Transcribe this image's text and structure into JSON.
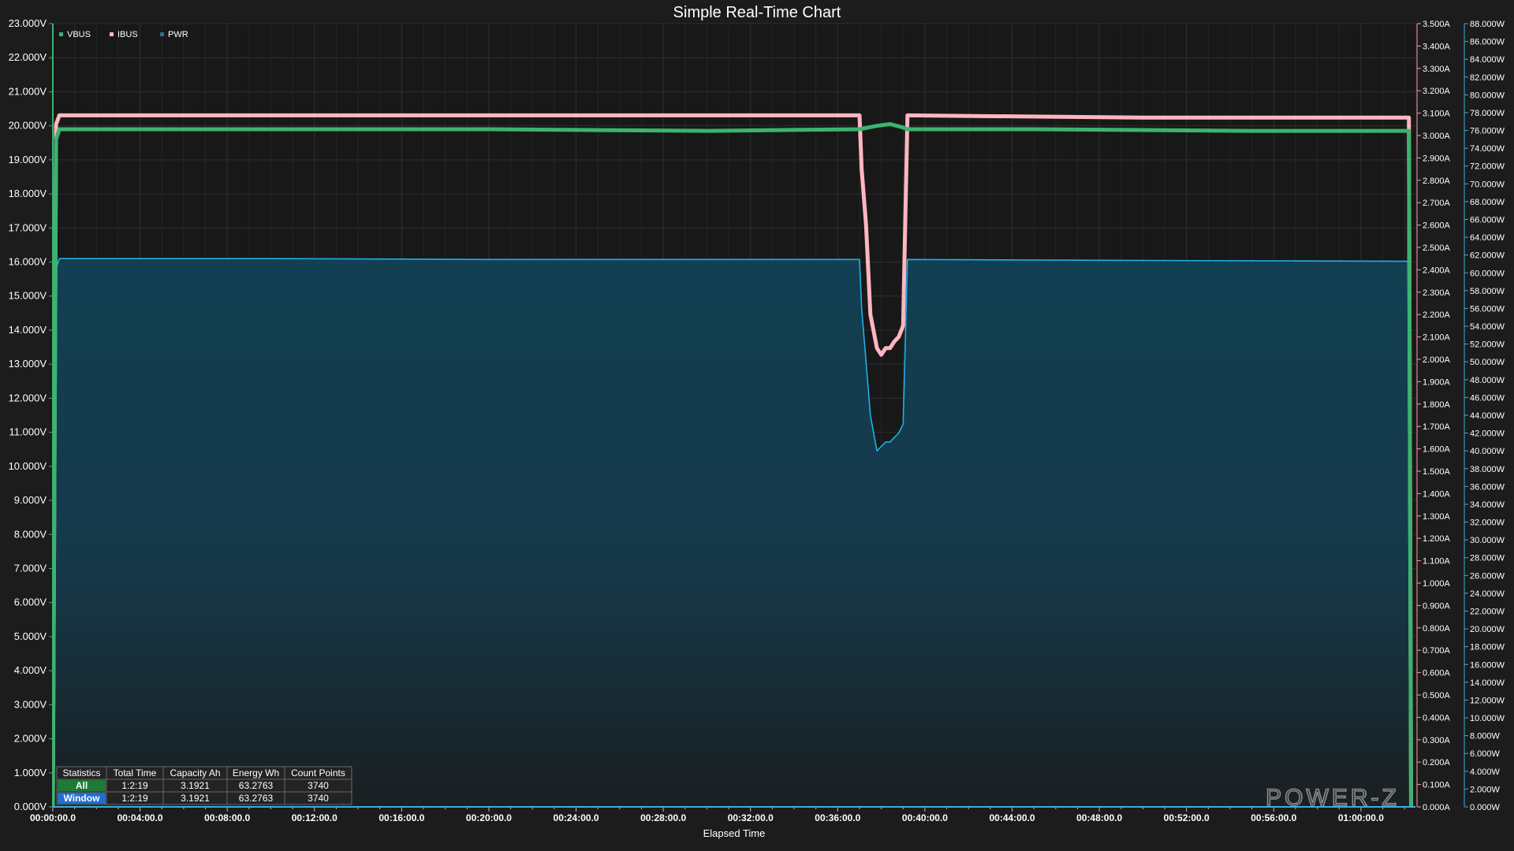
{
  "chart_data": {
    "type": "line",
    "title": "Simple Real-Time Chart",
    "xlabel": "Elapsed Time",
    "x_unit": "minutes",
    "xlim": [
      0,
      62.5
    ],
    "x_ticks": [
      {
        "value": 0,
        "label": "00:00:00.0"
      },
      {
        "value": 4,
        "label": "00:04:00.0"
      },
      {
        "value": 8,
        "label": "00:08:00.0"
      },
      {
        "value": 12,
        "label": "00:12:00.0"
      },
      {
        "value": 16,
        "label": "00:16:00.0"
      },
      {
        "value": 20,
        "label": "00:20:00.0"
      },
      {
        "value": 24,
        "label": "00:24:00.0"
      },
      {
        "value": 28,
        "label": "00:28:00.0"
      },
      {
        "value": 32,
        "label": "00:32:00.0"
      },
      {
        "value": 36,
        "label": "00:36:00.0"
      },
      {
        "value": 40,
        "label": "00:40:00.0"
      },
      {
        "value": 44,
        "label": "00:44:00.0"
      },
      {
        "value": 48,
        "label": "00:48:00.0"
      },
      {
        "value": 52,
        "label": "00:52:00.0"
      },
      {
        "value": 56,
        "label": "00:56:00.0"
      },
      {
        "value": 60,
        "label": "01:00:00.0"
      }
    ],
    "axes": {
      "voltage": {
        "ylim": [
          0,
          23
        ],
        "step": 1,
        "unit": "V",
        "decimals": 3
      },
      "current": {
        "ylim": [
          0,
          3.5
        ],
        "step": 0.1,
        "unit": "A",
        "decimals": 3
      },
      "power": {
        "ylim": [
          0,
          88
        ],
        "step": 2,
        "unit": "W",
        "decimals": 3
      }
    },
    "legend": {
      "placement": "top-left",
      "items": [
        {
          "name": "VBUS",
          "color": "#3cb371"
        },
        {
          "name": "IBUS",
          "color": "#ffb6c1"
        },
        {
          "name": "PWR",
          "color": "#2b6f8a"
        }
      ]
    },
    "grid": true,
    "series": [
      {
        "name": "VBUS",
        "axis": "voltage",
        "color": "#3cb371",
        "x": [
          0,
          0.15,
          0.3,
          10,
          20,
          30,
          37.0,
          37.8,
          38.4,
          39.0,
          39.2,
          45,
          55,
          62.2,
          62.3
        ],
        "y": [
          0,
          19.6,
          19.9,
          19.9,
          19.9,
          19.85,
          19.9,
          20.0,
          20.05,
          19.95,
          19.9,
          19.9,
          19.85,
          19.85,
          0
        ]
      },
      {
        "name": "IBUS",
        "axis": "current",
        "color": "#ffb6c1",
        "x": [
          0,
          0.15,
          0.3,
          20,
          37.0,
          37.1,
          37.3,
          37.5,
          37.8,
          38.0,
          38.2,
          38.4,
          38.6,
          38.8,
          39.0,
          39.2,
          50,
          62.2,
          62.3
        ],
        "y": [
          0,
          3.05,
          3.09,
          3.09,
          3.09,
          2.85,
          2.6,
          2.2,
          2.05,
          2.02,
          2.05,
          2.05,
          2.08,
          2.1,
          2.15,
          3.09,
          3.08,
          3.08,
          0
        ]
      },
      {
        "name": "PWR",
        "axis": "power",
        "color": "#1fb0e6",
        "fill": "#1d4a5c",
        "x": [
          0,
          0.15,
          0.3,
          10,
          20,
          30,
          37.0,
          37.1,
          37.3,
          37.5,
          37.8,
          38.0,
          38.2,
          38.4,
          38.6,
          38.8,
          39.0,
          39.2,
          50,
          62.2,
          62.3
        ],
        "y": [
          0,
          60.5,
          61.6,
          61.6,
          61.5,
          61.5,
          61.5,
          56,
          50,
          44,
          40,
          40.5,
          41,
          41,
          41.5,
          42,
          43,
          61.5,
          61.4,
          61.3,
          0
        ]
      }
    ]
  },
  "stats": {
    "headers": [
      "Statistics",
      "Total Time",
      "Capacity Ah",
      "Energy Wh",
      "Count Points"
    ],
    "rows": [
      {
        "label": "All",
        "color": "#1e7a34",
        "values": [
          "1:2:19",
          "3.1921",
          "63.2763",
          "3740"
        ]
      },
      {
        "label": "Window",
        "color": "#1f6fd0",
        "values": [
          "1:2:19",
          "3.1921",
          "63.2763",
          "3740"
        ]
      }
    ]
  },
  "brand": "POWER-Z"
}
